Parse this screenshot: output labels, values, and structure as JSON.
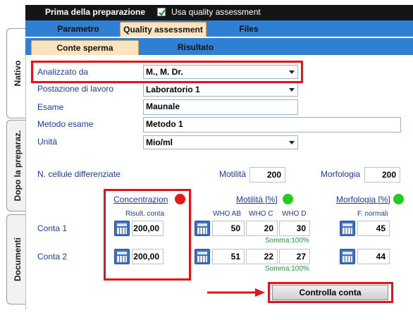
{
  "vertical_tabs": [
    {
      "label": "Nativo"
    },
    {
      "label": "Dopo la preparaz."
    },
    {
      "label": "Documenti"
    }
  ],
  "header": {
    "title": "Prima della preparazione",
    "checkbox_label": "Usa quality assessment",
    "checkbox_checked": true
  },
  "tabs": [
    {
      "label": "Parametro"
    },
    {
      "label": "Quality assessment"
    },
    {
      "label": "Files"
    }
  ],
  "subtabs": [
    {
      "label": "Conte sperma"
    },
    {
      "label": "Risultato"
    }
  ],
  "form": {
    "analizzato_label": "Analizzato da",
    "analizzato_value": "M., M. Dr.",
    "postazione_label": "Postazione di lavoro",
    "postazione_value": "Laboratorio 1",
    "esame_label": "Esame",
    "esame_value": "Maunale",
    "metodo_label": "Metodo esame",
    "metodo_value": "Metodo 1",
    "unita_label": "Unità",
    "unita_value": "Mio/ml"
  },
  "cells": {
    "label": "N. cellule differenziate",
    "motilita_label": "Motilità",
    "motilita_value": "200",
    "morfologia_label": "Morfologia",
    "morfologia_value": "200"
  },
  "concentrazione": {
    "title": "Concentrazion",
    "status_color": "#e81818",
    "sub": "Risult. conta",
    "conta1": "200,00",
    "conta2": "200,00"
  },
  "motilita": {
    "title": "Motilità [%]",
    "status_color": "#22cc22",
    "col1": "WHO AB",
    "col2": "WHO C",
    "col3": "WHO D",
    "conta1": [
      "50",
      "20",
      "30"
    ],
    "conta2": [
      "51",
      "22",
      "27"
    ],
    "somma1": "Somma:100%",
    "somma2": "Somma:100%"
  },
  "morfologia": {
    "title": "Morfologia [%]",
    "status_color": "#22cc22",
    "sub": "F. normali",
    "conta1": "45",
    "conta2": "44"
  },
  "rows": {
    "conta1": "Conta 1",
    "conta2": "Conta 2"
  },
  "button": {
    "label": "Controlla conta"
  },
  "annotation_color": "#e0141a"
}
